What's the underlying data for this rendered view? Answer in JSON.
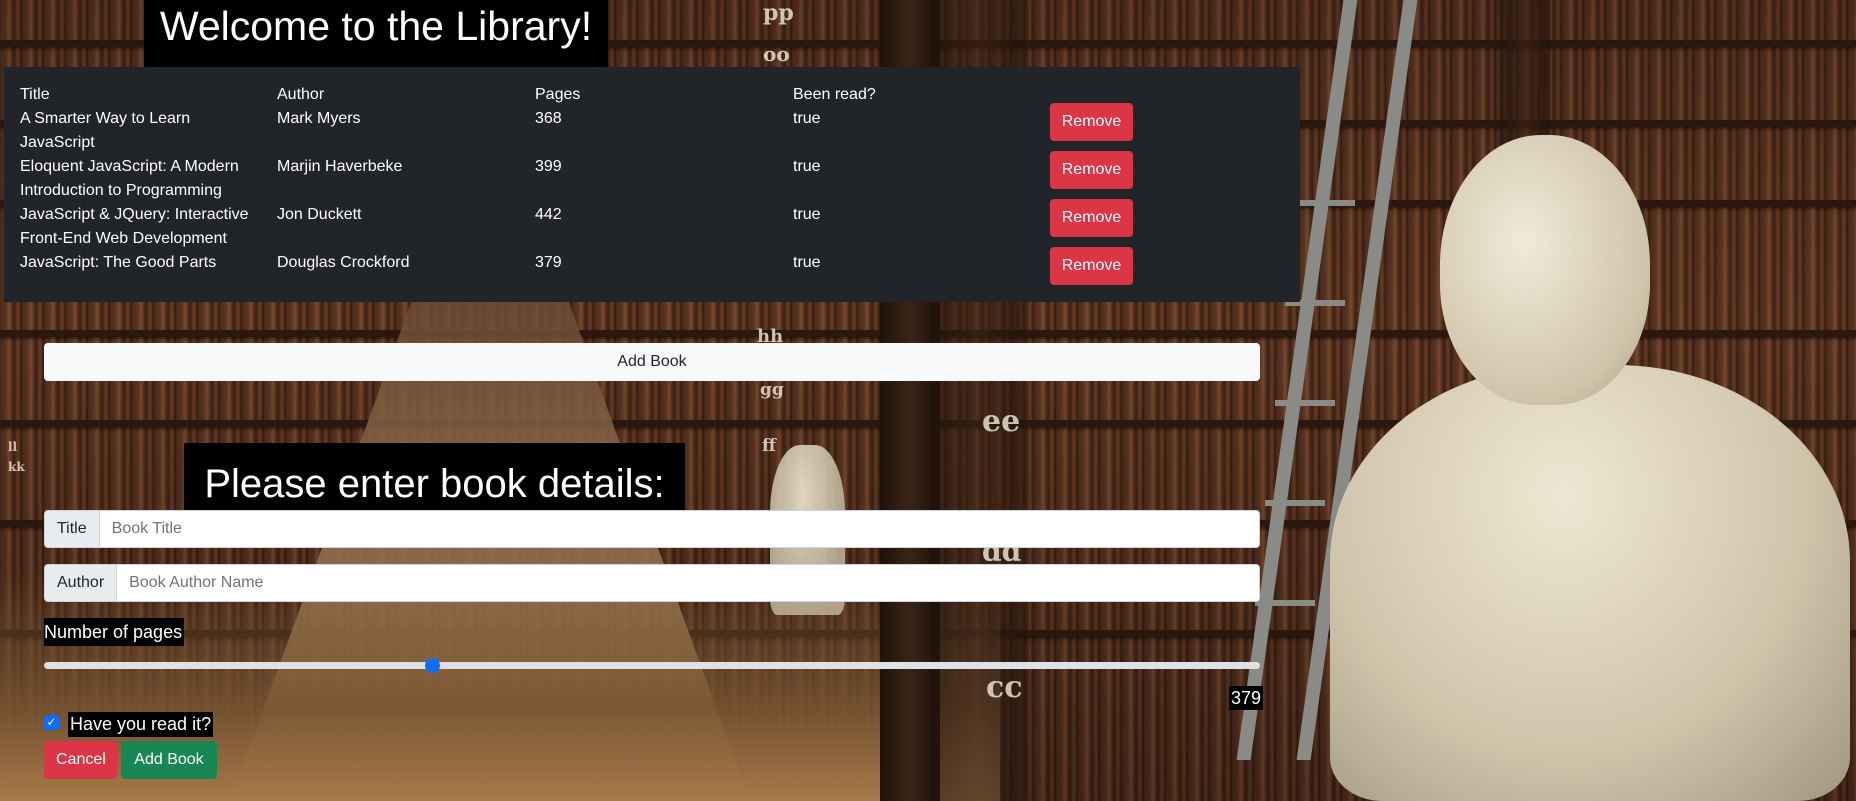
{
  "header": {
    "title": "Welcome to the Library!"
  },
  "table": {
    "columns": [
      "Title",
      "Author",
      "Pages",
      "Been read?"
    ],
    "remove_label": "Remove",
    "rows": [
      {
        "title": "A Smarter Way to Learn JavaScript",
        "author": "Mark Myers",
        "pages": "368",
        "read": "true"
      },
      {
        "title": "Eloquent JavaScript: A Modern Introduction to Programming",
        "author": "Marjin Haverbeke",
        "pages": "399",
        "read": "true"
      },
      {
        "title": "JavaScript & JQuery: Interactive Front-End Web Development",
        "author": "Jon Duckett",
        "pages": "442",
        "read": "true"
      },
      {
        "title": "JavaScript: The Good Parts",
        "author": "Douglas Crockford",
        "pages": "379",
        "read": "true"
      }
    ]
  },
  "add_toggle_label": "Add Book",
  "form": {
    "heading": "Please enter book details:",
    "title_label": "Title",
    "title_placeholder": "Book Title",
    "title_value": "",
    "author_label": "Author",
    "author_placeholder": "Book Author Name",
    "author_value": "",
    "pages_label": "Number of pages",
    "pages_value": "379",
    "pages_slider_fraction": 0.319,
    "read_label": "Have you read it?",
    "read_checked": true,
    "cancel_label": "Cancel",
    "submit_label": "Add Book"
  },
  "colors": {
    "danger": "#dc3545",
    "success": "#198754",
    "primary": "#0d6efd",
    "table_bg": "#212529",
    "light": "#f8f9fa"
  },
  "background": {
    "shelf_letters": [
      "pp",
      "oo",
      "hh",
      "gg",
      "ff",
      "ee",
      "dd",
      "cc",
      "ll",
      "kk"
    ]
  }
}
